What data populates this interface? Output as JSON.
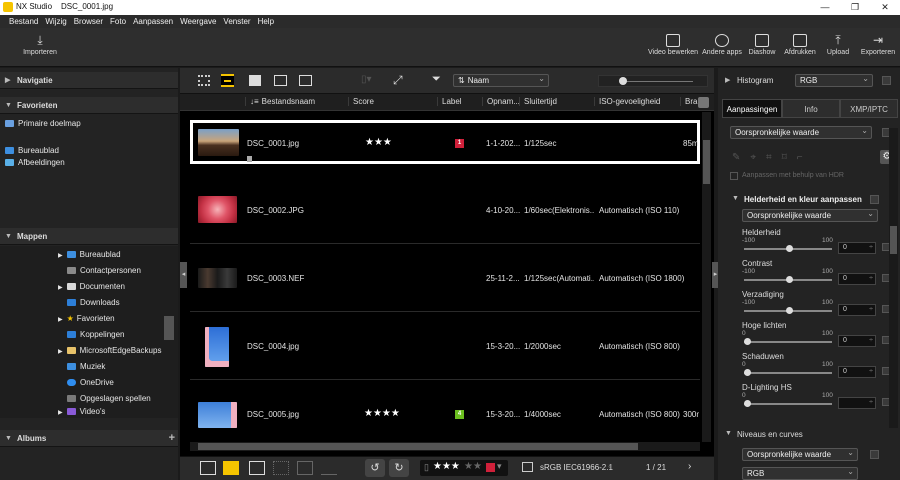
{
  "window": {
    "app": "NX Studio",
    "file": "DSC_0001.jpg"
  },
  "menu": [
    "Bestand",
    "Wijzig",
    "Browser",
    "Foto",
    "Aanpassen",
    "Weergave",
    "Venster",
    "Help"
  ],
  "toolbar": {
    "import": "Importeren",
    "right": [
      "Video bewerken",
      "Andere apps",
      "Diashow",
      "Afdrukken",
      "Upload",
      "Exporteren"
    ]
  },
  "left": {
    "navigation": "Navigatie",
    "favorites": "Favorieten",
    "primary_target": "Primaire doelmap",
    "fav_items": [
      "Bureaublad",
      "Afbeeldingen"
    ],
    "folders": "Mappen",
    "folder_items": [
      "Bureaublad",
      "Contactpersonen",
      "Documenten",
      "Downloads",
      "Favorieten",
      "Koppelingen",
      "MicrosoftEdgeBackups",
      "Muziek",
      "OneDrive",
      "Opgeslagen spellen",
      "Video's"
    ],
    "albums": "Albums"
  },
  "center": {
    "sort": "Naam",
    "columns": [
      "Bestandsnaam",
      "Score",
      "Label",
      "Opnam...",
      "Sluitertijd",
      "ISO-gevoeligheid",
      "Bra..."
    ],
    "rows": [
      {
        "name": "DSC_0001.jpg",
        "stars": "★★★",
        "label": "1",
        "label_color": "#d0203a",
        "date": "1-1-202...",
        "shutter": "1/125sec",
        "iso": "",
        "extra": "85mm"
      },
      {
        "name": "DSC_0002.JPG",
        "stars": "",
        "label": "",
        "label_color": "",
        "date": "4-10-20...",
        "shutter": "1/60sec(Elektronis...",
        "iso": "Automatisch (ISO 110)",
        "extra": "30mm"
      },
      {
        "name": "DSC_0003.NEF",
        "stars": "",
        "label": "",
        "label_color": "",
        "date": "25-11-2...",
        "shutter": "1/125sec(Automati...",
        "iso": "Automatisch (ISO 1800)",
        "extra": "30mm"
      },
      {
        "name": "DSC_0004.jpg",
        "stars": "",
        "label": "",
        "label_color": "",
        "date": "15-3-20...",
        "shutter": "1/2000sec",
        "iso": "Automatisch (ISO 800)",
        "extra": "300mm"
      },
      {
        "name": "DSC_0005.jpg",
        "stars": "★★★★",
        "label": "4",
        "label_color": "#6bbf1f",
        "date": "15-3-20...",
        "shutter": "1/4000sec",
        "iso": "Automatisch (ISO 800)",
        "extra": "300mm"
      }
    ],
    "bottom": {
      "rating_stars": "★★★",
      "color_space": "sRGB IEC61966-2.1",
      "page": "1 / 21"
    }
  },
  "right": {
    "histogram": "Histogram",
    "hist_mode": "RGB",
    "tabs": [
      "Aanpassingen",
      "Info",
      "XMP/IPTC"
    ],
    "preset": "Oorspronkelijke waarde",
    "hdr": "Aanpassen met behulp van HDR",
    "section1": "Helderheid en kleur aanpassen",
    "section1_preset": "Oorspronkelijke waarde",
    "sliders": [
      {
        "name": "Helderheid",
        "min": "-100",
        "max": "100",
        "value": "0",
        "pos": 0.5
      },
      {
        "name": "Contrast",
        "min": "-100",
        "max": "100",
        "value": "0",
        "pos": 0.5
      },
      {
        "name": "Verzadiging",
        "min": "-100",
        "max": "100",
        "value": "0",
        "pos": 0.5
      },
      {
        "name": "Hoge lichten",
        "min": "0",
        "max": "100",
        "value": "0",
        "pos": 0
      },
      {
        "name": "Schaduwen",
        "min": "0",
        "max": "100",
        "value": "0",
        "pos": 0
      },
      {
        "name": "D-Lighting HS",
        "min": "0",
        "max": "100",
        "value": "",
        "pos": 0
      }
    ],
    "section2": "Niveaus en curves",
    "section2_preset": "Oorspronkelijke waarde",
    "section2_mode": "RGB"
  }
}
